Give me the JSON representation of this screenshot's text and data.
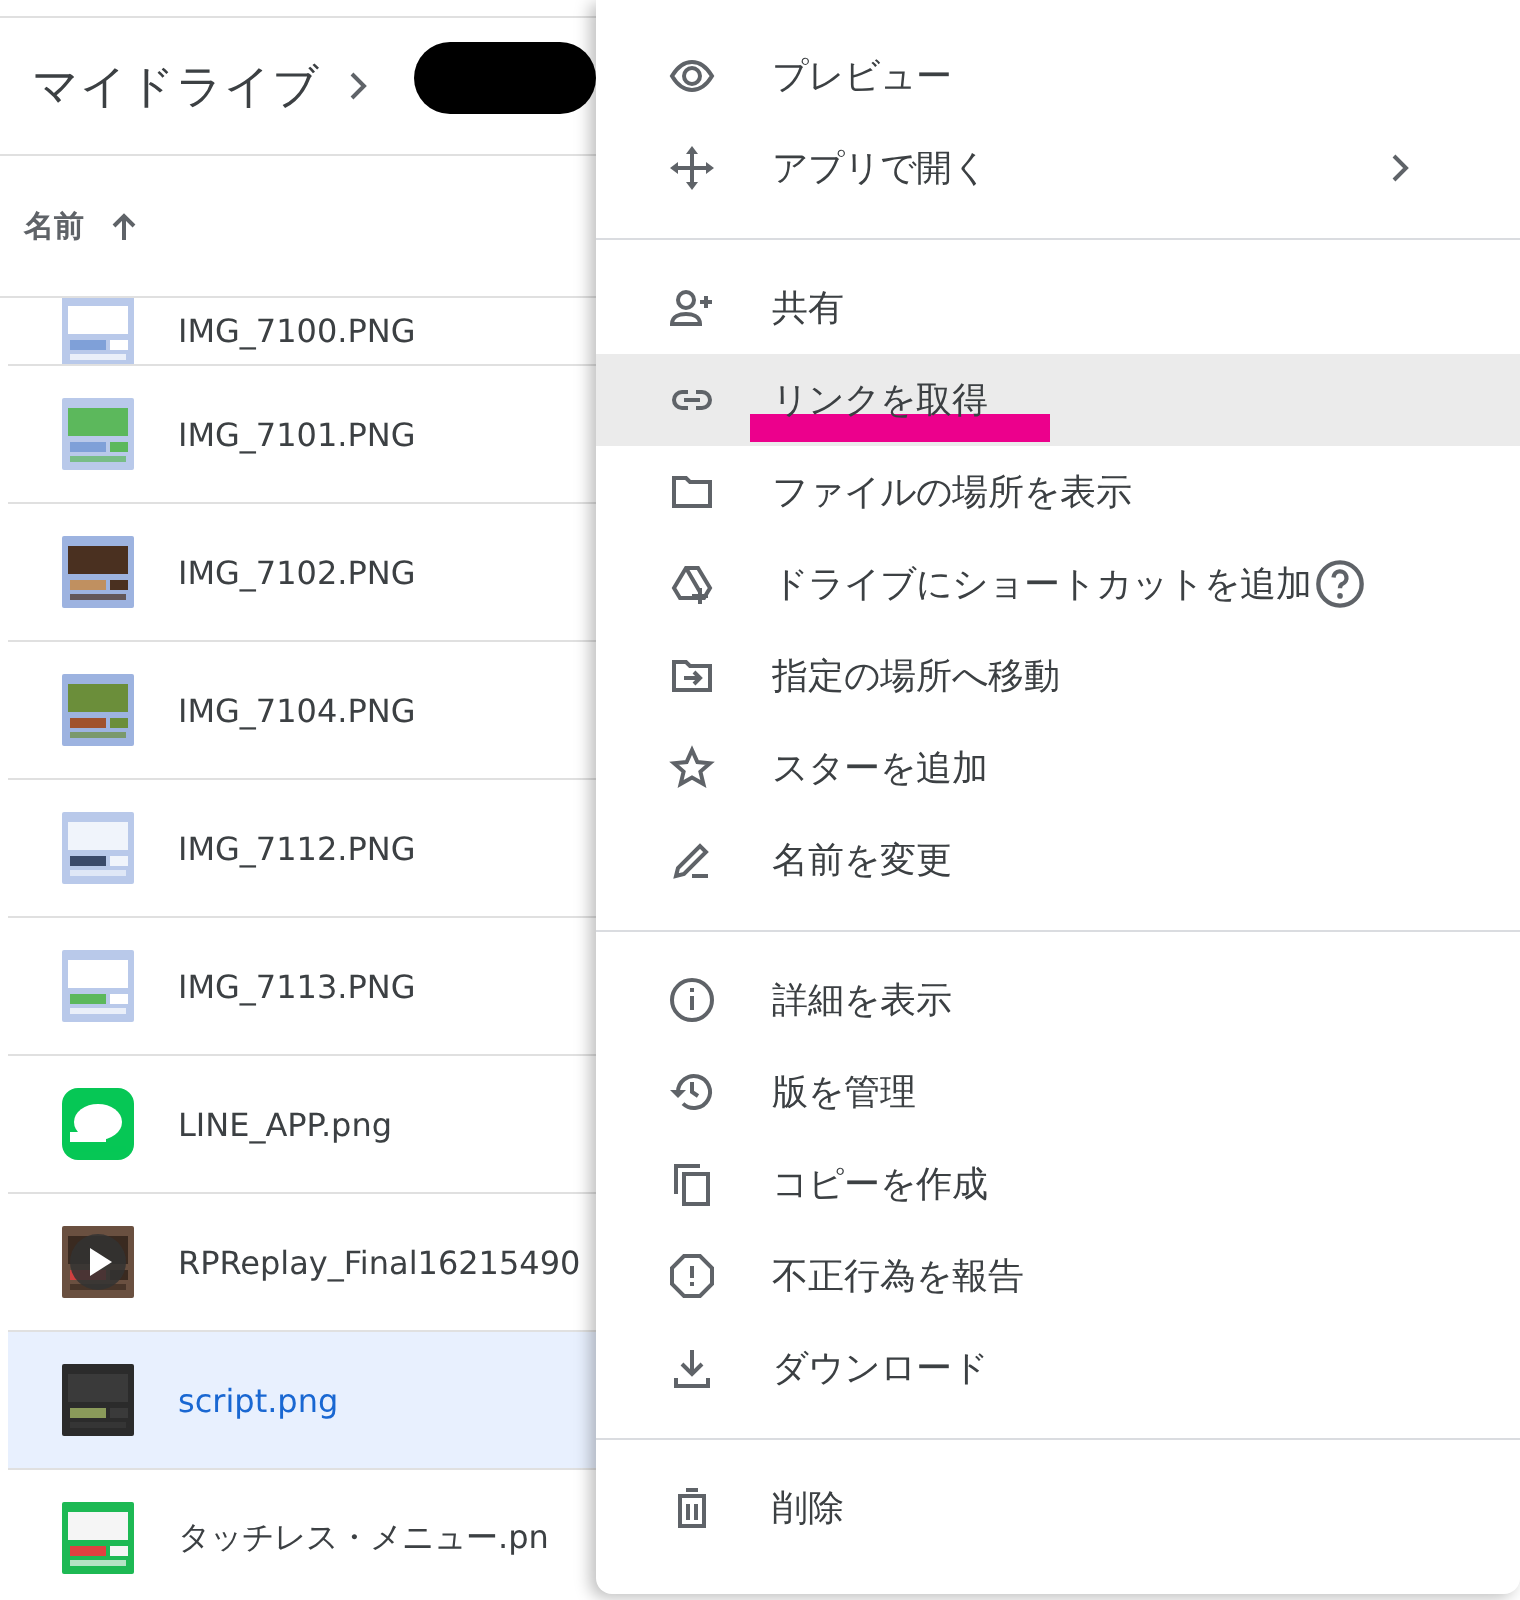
{
  "breadcrumb": {
    "root": "マイドライブ"
  },
  "list_header": {
    "label": "名前",
    "sorted_ascending": true
  },
  "files": [
    {
      "name": "IMG_7100.PNG",
      "selected": false
    },
    {
      "name": "IMG_7101.PNG",
      "selected": false
    },
    {
      "name": "IMG_7102.PNG",
      "selected": false
    },
    {
      "name": "IMG_7104.PNG",
      "selected": false
    },
    {
      "name": "IMG_7112.PNG",
      "selected": false
    },
    {
      "name": "IMG_7113.PNG",
      "selected": false
    },
    {
      "name": "LINE_APP.png",
      "selected": false
    },
    {
      "name": "RPReplay_Final16215490",
      "kind": "video",
      "selected": false
    },
    {
      "name": "script.png",
      "selected": true
    },
    {
      "name": "タッチレス・メニュー.pn",
      "selected": false
    }
  ],
  "context_menu": {
    "groups": [
      [
        {
          "label": "プレビュー",
          "highlighted": false
        },
        {
          "label": "アプリで開く",
          "highlighted": false,
          "submenu": true
        }
      ],
      [
        {
          "label": "共有",
          "highlighted": false
        },
        {
          "label": "リンクを取得",
          "highlighted": true,
          "marked": true
        },
        {
          "label": "ファイルの場所を表示",
          "highlighted": false
        },
        {
          "label": "ドライブにショートカットを追加",
          "highlighted": false,
          "help": true
        },
        {
          "label": "指定の場所へ移動",
          "highlighted": false
        },
        {
          "label": "スターを追加",
          "highlighted": false
        },
        {
          "label": "名前を変更",
          "highlighted": false
        }
      ],
      [
        {
          "label": "詳細を表示",
          "highlighted": false
        },
        {
          "label": "版を管理",
          "highlighted": false
        },
        {
          "label": "コピーを作成",
          "highlighted": false
        },
        {
          "label": "不正行為を報告",
          "highlighted": false
        },
        {
          "label": "ダウンロード",
          "highlighted": false
        }
      ],
      [
        {
          "label": "削除",
          "highlighted": false
        }
      ]
    ]
  }
}
